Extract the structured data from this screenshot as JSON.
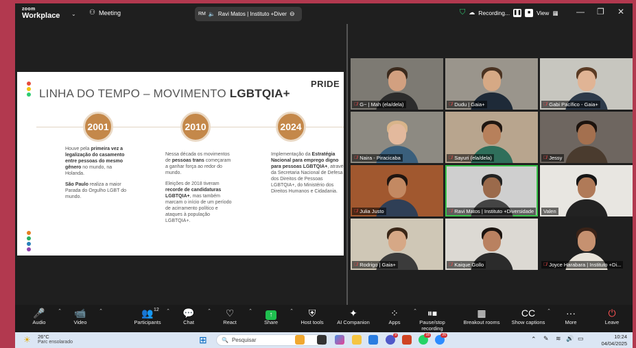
{
  "titlebar": {
    "brand_top": "zoom",
    "brand_name": "Workplace",
    "meeting_label": "Meeting",
    "speaker_initials": "RM",
    "speaker_name": "Ravi Matos | Instituto +Diver",
    "recording_label": "Recording...",
    "view_label": "View"
  },
  "slide": {
    "title_plain": "LINHA DO TEMPO – MOVIMENTO ",
    "title_bold": "LGBTQIA+",
    "logo": "PRIDE",
    "dot_colors_top": [
      "#e74c3c",
      "#f1c40f",
      "#2ecc71"
    ],
    "dot_colors_bottom": [
      "#e67e22",
      "#27ae60",
      "#2980b9",
      "#8e44ad"
    ],
    "columns": [
      {
        "year": "2001",
        "paragraphs": [
          [
            {
              "t": "Houve pela ",
              "b": false
            },
            {
              "t": "primeira vez a legalização do casamento entre pessoas do mesmo gênero",
              "b": true
            },
            {
              "t": " no mundo, na Holanda.",
              "b": false
            }
          ],
          [
            {
              "t": "São Paulo",
              "b": true
            },
            {
              "t": " realiza a maior Parada do Orgulho LGBT do mundo.",
              "b": false
            }
          ]
        ]
      },
      {
        "year": "2010",
        "paragraphs": [
          [
            {
              "t": "Nessa década os movimentos de ",
              "b": false
            },
            {
              "t": "pessoas trans",
              "b": true
            },
            {
              "t": " começaram a ganhar força ao redor do mundo.",
              "b": false
            }
          ],
          [
            {
              "t": "Eleições de 2018 tiveram ",
              "b": false
            },
            {
              "t": "recorde de candidaturas LGBTQIA+",
              "b": true
            },
            {
              "t": ", mas também marcam o início de um período de acirramento político e ataques à população LGBTQIA+.",
              "b": false
            }
          ]
        ]
      },
      {
        "year": "2024",
        "paragraphs": [
          [
            {
              "t": "Implementação da ",
              "b": false
            },
            {
              "t": "Estratégia Nacional para emprego digno para pessoas LGBTQIA+",
              "b": true
            },
            {
              "t": ", através da Secretaria Nacional de Defesa dos Direitos de Pessoas LGBTQIA+, do Ministério dos Direitos Humanos e Cidadania.",
              "b": false
            }
          ]
        ]
      }
    ]
  },
  "participants": [
    {
      "name": "G~ | Mah (ela/dela)",
      "muted": true,
      "bg": "#7d7a73",
      "skin": "#d2a080",
      "hair": "#3b2a1d",
      "shirt": "#2c2c2c",
      "active": false
    },
    {
      "name": "Dudu | Gaia+",
      "muted": true,
      "bg": "#9a958c",
      "skin": "#d6a985",
      "hair": "#4a3322",
      "shirt": "#1e2a38",
      "active": false
    },
    {
      "name": "Gabi Pacífico - Gaia+",
      "muted": true,
      "bg": "#c7c6bf",
      "skin": "#e0b495",
      "hair": "#5a3b24",
      "shirt": "#2d3a4a",
      "active": false
    },
    {
      "name": "Naira - Piracicaba",
      "muted": true,
      "bg": "#8d8a82",
      "skin": "#e3b99d",
      "hair": "#d8b48a",
      "shirt": "#3a5f7c",
      "active": false
    },
    {
      "name": "Sayuri (ela/dela)",
      "muted": true,
      "bg": "#b8a58e",
      "skin": "#b7805b",
      "hair": "#1f1611",
      "shirt": "#2f6f5b",
      "active": false
    },
    {
      "name": "Jessy",
      "muted": true,
      "bg": "#6e6660",
      "skin": "#a4704f",
      "hair": "#1c130e",
      "shirt": "#4a3b2e",
      "active": false
    },
    {
      "name": "Julia Justo",
      "muted": true,
      "bg": "#a1582f",
      "skin": "#c38962",
      "hair": "#1f1510",
      "shirt": "#2f3f56",
      "active": false
    },
    {
      "name": "Ravi Matos | Instituto +Diversidade",
      "muted": true,
      "bg": "#cfcfcf",
      "skin": "#9b6a4b",
      "hair": "#222222",
      "shirt": "#444444",
      "active": true
    },
    {
      "name": "Valen",
      "muted": false,
      "bg": "#e8e6e1",
      "skin": "#b07a58",
      "hair": "#151515",
      "shirt": "#222222",
      "active": false
    },
    {
      "name": "Rodrigo | Gaia+",
      "muted": true,
      "bg": "#cfc7b6",
      "skin": "#d6a886",
      "hair": "#3a2718",
      "shirt": "#3b3b3b",
      "active": false
    },
    {
      "name": "Kaique Gollo",
      "muted": true,
      "bg": "#dcd9d3",
      "skin": "#b98160",
      "hair": "#1b1410",
      "shirt": "#2b2b2b",
      "active": false
    },
    {
      "name": "Joyce Harabara | Instituto +Di...",
      "muted": true,
      "bg": "#1f1f1f",
      "skin": "#c69170",
      "hair": "#3a2318",
      "shirt": "#e7e2d8",
      "active": false
    }
  ],
  "toolbar": [
    {
      "name": "audio",
      "label": "Audio",
      "icon": "🎤",
      "caret": true,
      "count": ""
    },
    {
      "name": "video",
      "label": "Video",
      "icon": "📹",
      "caret": true,
      "count": ""
    },
    {
      "name": "participants",
      "label": "Participants",
      "icon": "👥",
      "caret": true,
      "count": "12"
    },
    {
      "name": "chat",
      "label": "Chat",
      "icon": "💬",
      "caret": true,
      "count": ""
    },
    {
      "name": "react",
      "label": "React",
      "icon": "♡",
      "caret": true,
      "count": ""
    },
    {
      "name": "share",
      "label": "Share",
      "icon": "↑",
      "caret": true,
      "count": ""
    },
    {
      "name": "host-tools",
      "label": "Host tools",
      "icon": "⛨",
      "caret": false,
      "count": ""
    },
    {
      "name": "ai-companion",
      "label": "AI Companion",
      "icon": "✦",
      "caret": false,
      "count": ""
    },
    {
      "name": "apps",
      "label": "Apps",
      "icon": "⁘",
      "caret": true,
      "count": ""
    },
    {
      "name": "pause-stop-recording",
      "label": "Pause/stop recording",
      "icon": "⏸⏹",
      "caret": false,
      "count": ""
    },
    {
      "name": "breakout-rooms",
      "label": "Breakout rooms",
      "icon": "▦",
      "caret": false,
      "count": ""
    },
    {
      "name": "show-captions",
      "label": "Show captions",
      "icon": "CC",
      "caret": true,
      "count": ""
    },
    {
      "name": "more",
      "label": "More",
      "icon": "···",
      "caret": false,
      "count": ""
    },
    {
      "name": "leave",
      "label": "Leave",
      "icon": "⏻",
      "caret": false,
      "count": ""
    }
  ],
  "taskbar": {
    "weather_temp": "26°C",
    "weather_desc": "Parc ensolarado",
    "search_placeholder": "Pesquisar",
    "time": "10:24",
    "date": "04/04/2025",
    "badge_teams": "9",
    "badge_whatsapp": "18",
    "badge_chat": "26"
  }
}
